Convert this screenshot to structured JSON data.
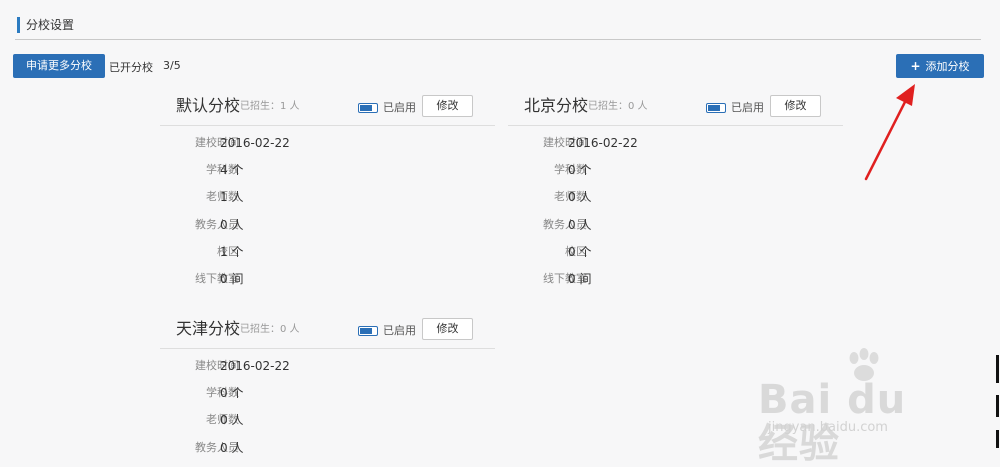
{
  "header": {
    "title": "分校设置"
  },
  "toolbar": {
    "apply_label": "申请更多分校",
    "opened_label": "已开分校",
    "opened_count": "3/5",
    "add_label": "添加分校"
  },
  "campuses": [
    {
      "name": "默认分校",
      "enrolled": "已招生：1 人",
      "status_label": "已启用",
      "edit_label": "修改",
      "rows": [
        {
          "label": "建校时间",
          "value": "2016-02-22"
        },
        {
          "label": "学科数",
          "value": "4 个"
        },
        {
          "label": "老师数",
          "value": "1 人"
        },
        {
          "label": "教务人员",
          "value": "0 人"
        },
        {
          "label": "校区",
          "value": "1 个"
        },
        {
          "label": "线下教室",
          "value": "0 间"
        }
      ]
    },
    {
      "name": "北京分校",
      "enrolled": "已招生：0 人",
      "status_label": "已启用",
      "edit_label": "修改",
      "rows": [
        {
          "label": "建校时间",
          "value": "2016-02-22"
        },
        {
          "label": "学科数",
          "value": "0 个"
        },
        {
          "label": "老师数",
          "value": "0 人"
        },
        {
          "label": "教务人员",
          "value": "0 人"
        },
        {
          "label": "校区",
          "value": "0 个"
        },
        {
          "label": "线下教室",
          "value": "0 间"
        }
      ]
    },
    {
      "name": "天津分校",
      "enrolled": "已招生：0 人",
      "status_label": "已启用",
      "edit_label": "修改",
      "rows": [
        {
          "label": "建校时间",
          "value": "2016-02-22"
        },
        {
          "label": "学科数",
          "value": "0 个"
        },
        {
          "label": "老师数",
          "value": "0 人"
        },
        {
          "label": "教务人员",
          "value": "0 人"
        }
      ]
    }
  ],
  "watermark": {
    "text": "Bai du 经验",
    "sub": "jingyan.baidu.com"
  },
  "colors": {
    "accent": "#2b6fb6",
    "arrow": "#e02020",
    "background": "#f7f7f8"
  }
}
